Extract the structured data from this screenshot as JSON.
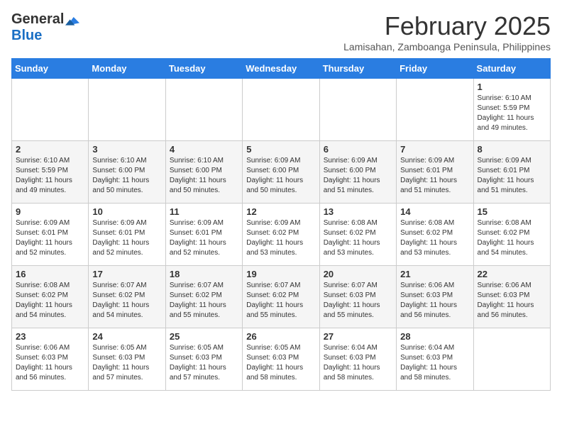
{
  "header": {
    "logo_general": "General",
    "logo_blue": "Blue",
    "month_title": "February 2025",
    "subtitle": "Lamisahan, Zamboanga Peninsula, Philippines"
  },
  "weekdays": [
    "Sunday",
    "Monday",
    "Tuesday",
    "Wednesday",
    "Thursday",
    "Friday",
    "Saturday"
  ],
  "weeks": [
    [
      {
        "day": "",
        "info": ""
      },
      {
        "day": "",
        "info": ""
      },
      {
        "day": "",
        "info": ""
      },
      {
        "day": "",
        "info": ""
      },
      {
        "day": "",
        "info": ""
      },
      {
        "day": "",
        "info": ""
      },
      {
        "day": "1",
        "info": "Sunrise: 6:10 AM\nSunset: 5:59 PM\nDaylight: 11 hours\nand 49 minutes."
      }
    ],
    [
      {
        "day": "2",
        "info": "Sunrise: 6:10 AM\nSunset: 5:59 PM\nDaylight: 11 hours\nand 49 minutes."
      },
      {
        "day": "3",
        "info": "Sunrise: 6:10 AM\nSunset: 6:00 PM\nDaylight: 11 hours\nand 50 minutes."
      },
      {
        "day": "4",
        "info": "Sunrise: 6:10 AM\nSunset: 6:00 PM\nDaylight: 11 hours\nand 50 minutes."
      },
      {
        "day": "5",
        "info": "Sunrise: 6:09 AM\nSunset: 6:00 PM\nDaylight: 11 hours\nand 50 minutes."
      },
      {
        "day": "6",
        "info": "Sunrise: 6:09 AM\nSunset: 6:00 PM\nDaylight: 11 hours\nand 51 minutes."
      },
      {
        "day": "7",
        "info": "Sunrise: 6:09 AM\nSunset: 6:01 PM\nDaylight: 11 hours\nand 51 minutes."
      },
      {
        "day": "8",
        "info": "Sunrise: 6:09 AM\nSunset: 6:01 PM\nDaylight: 11 hours\nand 51 minutes."
      }
    ],
    [
      {
        "day": "9",
        "info": "Sunrise: 6:09 AM\nSunset: 6:01 PM\nDaylight: 11 hours\nand 52 minutes."
      },
      {
        "day": "10",
        "info": "Sunrise: 6:09 AM\nSunset: 6:01 PM\nDaylight: 11 hours\nand 52 minutes."
      },
      {
        "day": "11",
        "info": "Sunrise: 6:09 AM\nSunset: 6:01 PM\nDaylight: 11 hours\nand 52 minutes."
      },
      {
        "day": "12",
        "info": "Sunrise: 6:09 AM\nSunset: 6:02 PM\nDaylight: 11 hours\nand 53 minutes."
      },
      {
        "day": "13",
        "info": "Sunrise: 6:08 AM\nSunset: 6:02 PM\nDaylight: 11 hours\nand 53 minutes."
      },
      {
        "day": "14",
        "info": "Sunrise: 6:08 AM\nSunset: 6:02 PM\nDaylight: 11 hours\nand 53 minutes."
      },
      {
        "day": "15",
        "info": "Sunrise: 6:08 AM\nSunset: 6:02 PM\nDaylight: 11 hours\nand 54 minutes."
      }
    ],
    [
      {
        "day": "16",
        "info": "Sunrise: 6:08 AM\nSunset: 6:02 PM\nDaylight: 11 hours\nand 54 minutes."
      },
      {
        "day": "17",
        "info": "Sunrise: 6:07 AM\nSunset: 6:02 PM\nDaylight: 11 hours\nand 54 minutes."
      },
      {
        "day": "18",
        "info": "Sunrise: 6:07 AM\nSunset: 6:02 PM\nDaylight: 11 hours\nand 55 minutes."
      },
      {
        "day": "19",
        "info": "Sunrise: 6:07 AM\nSunset: 6:02 PM\nDaylight: 11 hours\nand 55 minutes."
      },
      {
        "day": "20",
        "info": "Sunrise: 6:07 AM\nSunset: 6:03 PM\nDaylight: 11 hours\nand 55 minutes."
      },
      {
        "day": "21",
        "info": "Sunrise: 6:06 AM\nSunset: 6:03 PM\nDaylight: 11 hours\nand 56 minutes."
      },
      {
        "day": "22",
        "info": "Sunrise: 6:06 AM\nSunset: 6:03 PM\nDaylight: 11 hours\nand 56 minutes."
      }
    ],
    [
      {
        "day": "23",
        "info": "Sunrise: 6:06 AM\nSunset: 6:03 PM\nDaylight: 11 hours\nand 56 minutes."
      },
      {
        "day": "24",
        "info": "Sunrise: 6:05 AM\nSunset: 6:03 PM\nDaylight: 11 hours\nand 57 minutes."
      },
      {
        "day": "25",
        "info": "Sunrise: 6:05 AM\nSunset: 6:03 PM\nDaylight: 11 hours\nand 57 minutes."
      },
      {
        "day": "26",
        "info": "Sunrise: 6:05 AM\nSunset: 6:03 PM\nDaylight: 11 hours\nand 58 minutes."
      },
      {
        "day": "27",
        "info": "Sunrise: 6:04 AM\nSunset: 6:03 PM\nDaylight: 11 hours\nand 58 minutes."
      },
      {
        "day": "28",
        "info": "Sunrise: 6:04 AM\nSunset: 6:03 PM\nDaylight: 11 hours\nand 58 minutes."
      },
      {
        "day": "",
        "info": ""
      }
    ]
  ]
}
